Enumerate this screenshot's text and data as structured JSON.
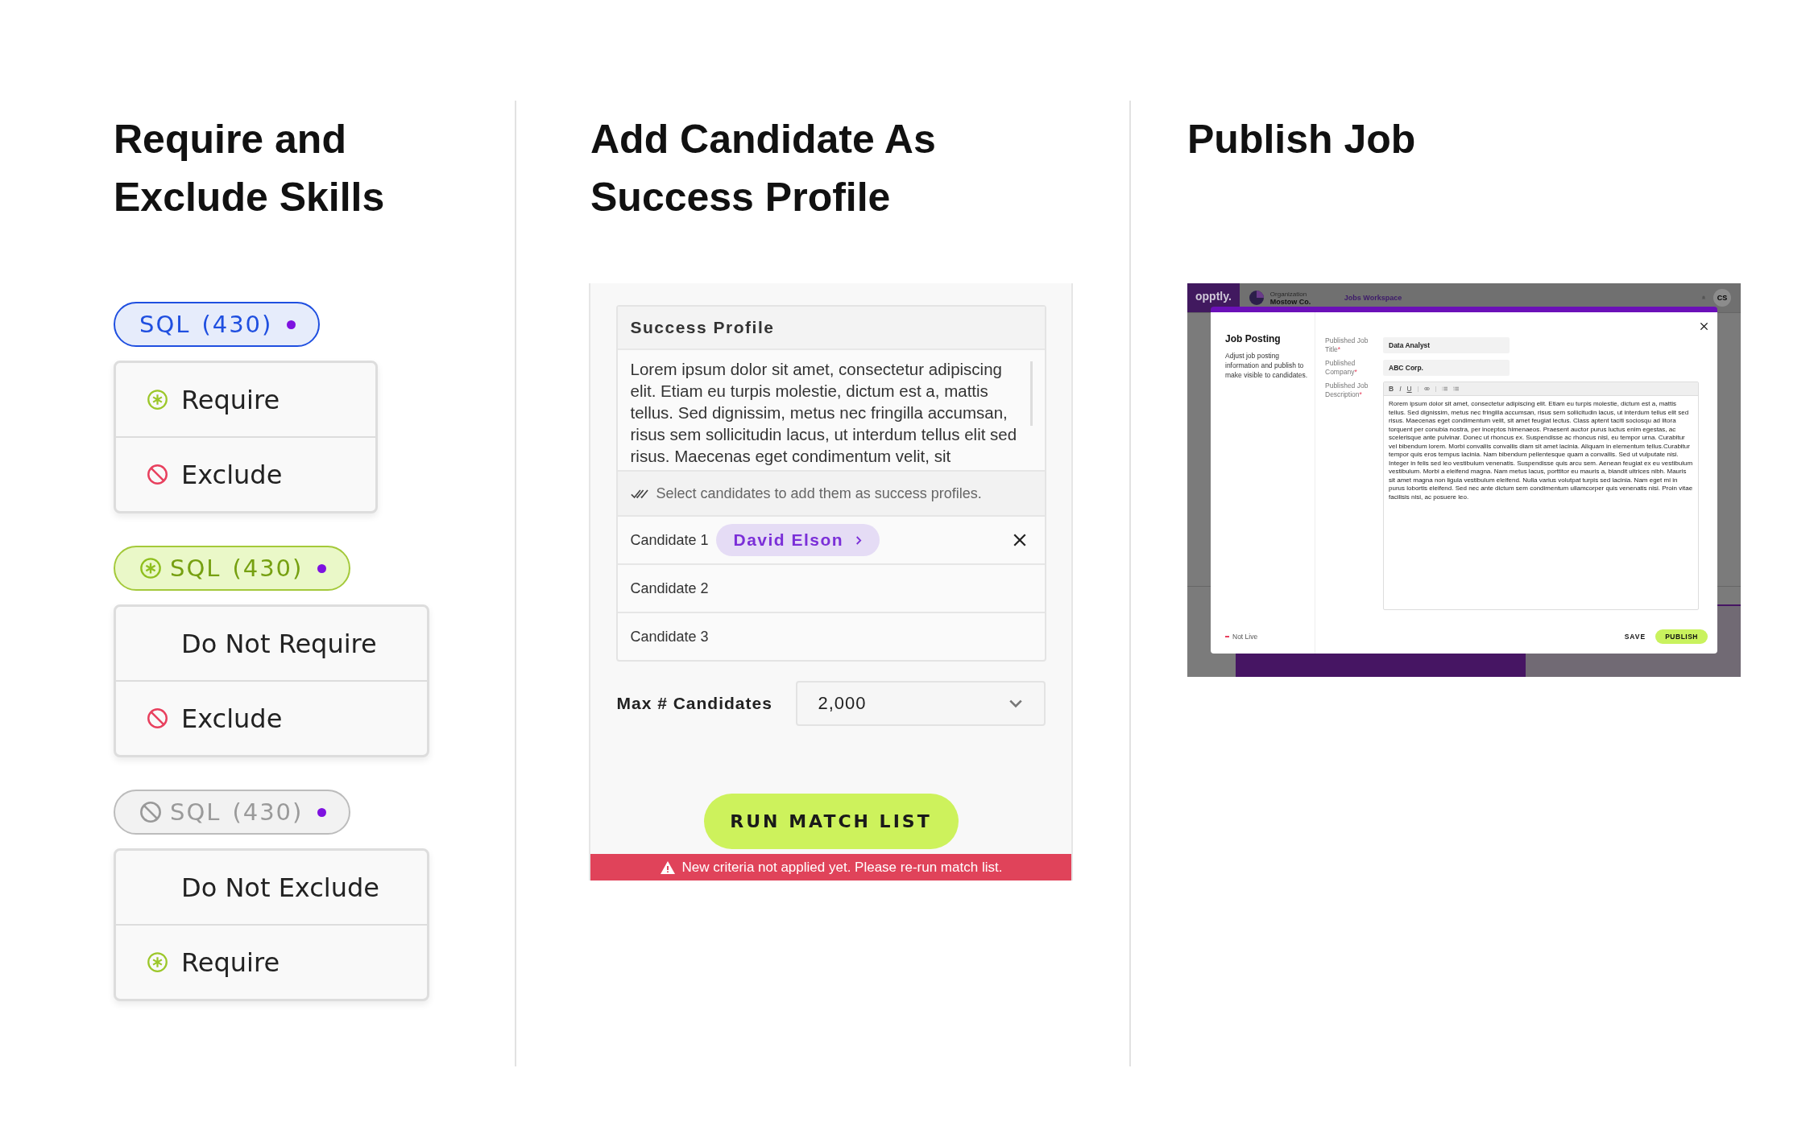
{
  "skills_panel": {
    "title": "Require and Exclude Skills",
    "filters": [
      {
        "kind": "neutral",
        "label": "SQL",
        "count": "(430)",
        "options": [
          {
            "kind": "require",
            "label": "Require"
          },
          {
            "kind": "exclude",
            "label": "Exclude"
          }
        ]
      },
      {
        "kind": "required",
        "label": "SQL",
        "count": "(430)",
        "options": [
          {
            "kind": "plain",
            "label": "Do Not Require"
          },
          {
            "kind": "exclude",
            "label": "Exclude"
          }
        ]
      },
      {
        "kind": "excluded",
        "label": "SQL",
        "count": "(430)",
        "options": [
          {
            "kind": "plain",
            "label": "Do Not Exclude"
          },
          {
            "kind": "require",
            "label": "Require"
          }
        ]
      }
    ]
  },
  "success_panel": {
    "title": "Add Candidate As Success Profile",
    "card_title": "Success Profile",
    "description": "Lorem ipsum dolor sit amet, consectetur adipiscing elit. Etiam eu turpis molestie, dictum est a, mattis tellus. Sed dignissim, metus nec fringilla accumsan, risus sem sollicitudin lacus, ut interdum tellus elit sed risus. Maecenas eget condimentum velit, sit",
    "hint": "Select candidates to add them as success profiles.",
    "candidates": [
      {
        "label": "Candidate 1",
        "value": "David Elson"
      },
      {
        "label": "Candidate 2"
      },
      {
        "label": "Candidate 3"
      }
    ],
    "max_label": "Max # Candidates",
    "max_value": "2,000",
    "run_button": "RUN MATCH LIST",
    "warning": "New criteria not applied yet. Please re-run match list."
  },
  "publish_panel": {
    "title": "Publish Job",
    "app_header": {
      "logo": "opptly.",
      "org_label": "Organization",
      "org_name": "Mostow Co.",
      "workspace": "Jobs Workspace",
      "avatar": "CS"
    },
    "modal": {
      "title": "Job Posting",
      "description": "Adjust job posting information and publish to make visible to candidates.",
      "fields": [
        {
          "label": "Published Job Title",
          "mark": "*",
          "value": "Data Analyst"
        },
        {
          "label": "Published Company",
          "mark": "*",
          "value": "ABC Corp."
        }
      ],
      "editor_label": "Published Job Description",
      "editor_mark": "*",
      "toolbar": [
        "B",
        "I",
        "U"
      ],
      "editor_text": "Rorem ipsum dolor sit amet, consectetur adipiscing elit. Etiam eu turpis molestie, dictum est a, mattis tellus. Sed dignissim, metus nec fringilla accumsan, risus sem sollicitudin lacus, ut interdum tellus elit sed risus. Maecenas eget condimentum velit, sit amet feugiat lectus. Class aptent taciti sociosqu ad litora torquent per conubia nostra, per inceptos himenaeos. Praesent auctor purus luctus enim egestas, ac scelerisque ante pulvinar. Donec ut rhoncus ex. Suspendisse ac rhoncus nisl, eu tempor urna. Curabitur vel bibendum lorem. Morbi convallis convallis diam sit amet lacinia. Aliquam in elementum tellus.Curabitur tempor quis eros tempus lacinia. Nam bibendum pellentesque quam a convallis. Sed ut vulputate nisi. Integer in felis sed leo vestibulum venenatis. Suspendisse quis arcu sem. Aenean feugiat ex eu vestibulum vestibulum. Morbi a eleifend magna. Nam metus lacus, porttitor eu mauris a, blandit ultrices nibh. Mauris sit amet magna non ligula vestibulum eleifend. Nulla varius volutpat turpis sed lacinia. Nam eget mi in purus lobortis eleifend. Sed nec ante dictum sem condimentum ullamcorper quis venenatis nisi. Proin vitae facilisis nisi, ac posuere leo.",
      "status": "Not Live",
      "save": "SAVE",
      "publish": "PUBLISH"
    }
  }
}
